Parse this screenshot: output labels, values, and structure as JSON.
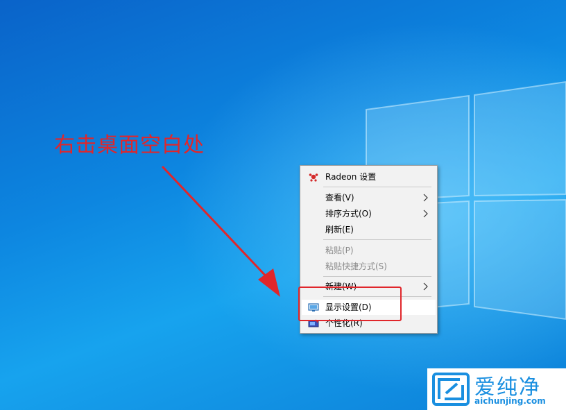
{
  "annotation": {
    "text": "右击桌面空白处",
    "color": "#e0262b"
  },
  "context_menu": {
    "items": [
      {
        "label": "Radeon 设置",
        "icon": "radeon-icon",
        "submenu": false,
        "enabled": true
      },
      {
        "label": "查看(V)",
        "submenu": true,
        "enabled": true
      },
      {
        "label": "排序方式(O)",
        "submenu": true,
        "enabled": true
      },
      {
        "label": "刷新(E)",
        "submenu": false,
        "enabled": true
      },
      {
        "label": "粘贴(P)",
        "submenu": false,
        "enabled": false
      },
      {
        "label": "粘贴快捷方式(S)",
        "submenu": false,
        "enabled": false
      },
      {
        "label": "新建(W)",
        "submenu": true,
        "enabled": true
      },
      {
        "label": "显示设置(D)",
        "icon": "display-icon",
        "submenu": false,
        "enabled": true,
        "highlighted": true
      },
      {
        "label": "个性化(R)",
        "icon": "personalize-icon",
        "submenu": false,
        "enabled": true
      }
    ]
  },
  "watermark": {
    "title": "爱纯净",
    "url": "aichunjing.com",
    "color": "#1a8fe0"
  },
  "colors": {
    "desktop_blue": "#0d86e0",
    "annotation_red": "#e0262b",
    "menu_background": "#f2f2f2"
  }
}
